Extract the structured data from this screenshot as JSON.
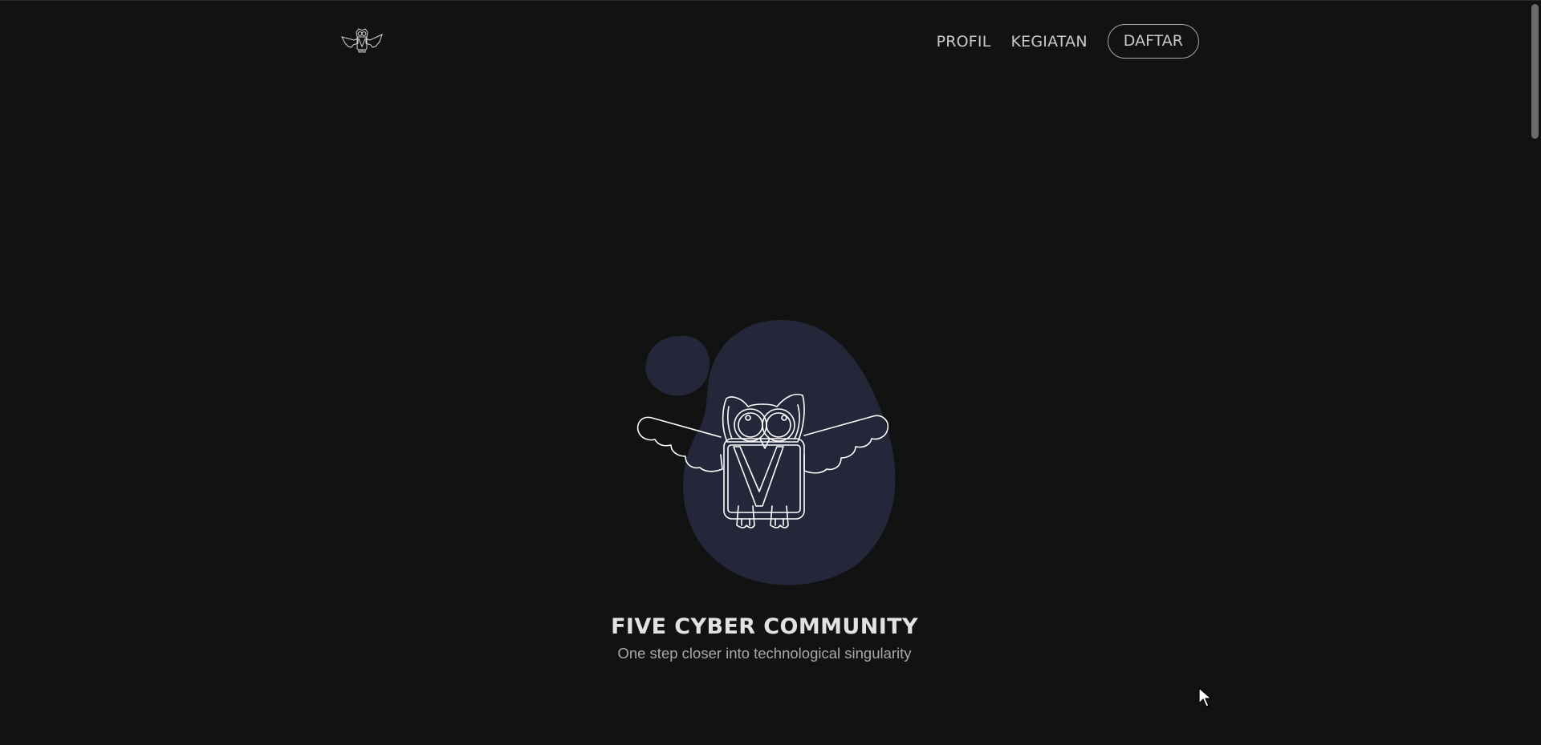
{
  "nav": {
    "links": [
      {
        "label": "PROFIL"
      },
      {
        "label": "KEGIATAN"
      }
    ],
    "cta_label": "DAFTAR"
  },
  "hero": {
    "title": "FIVE CYBER COMMUNITY",
    "subtitle": "One step closer into technological singularity"
  },
  "colors": {
    "background": "#121212",
    "blob": "#24263a",
    "line": "#ffffff"
  },
  "icons": {
    "logo": "owl-logo-icon",
    "hero": "owl-illustration-icon",
    "cursor": "mouse-cursor-icon"
  }
}
